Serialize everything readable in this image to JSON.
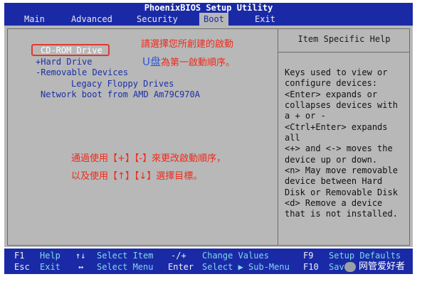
{
  "title": "PhoenixBIOS Setup Utility",
  "menu": {
    "items": [
      {
        "label": "Main"
      },
      {
        "label": "Advanced"
      },
      {
        "label": "Security"
      },
      {
        "label": "Boot"
      },
      {
        "label": "Exit"
      }
    ],
    "active": "Boot"
  },
  "boot": {
    "items": [
      {
        "label": "CD-ROM Drive",
        "selected": true
      },
      {
        "label": "+Hard Drive"
      },
      {
        "label": "-Removable Devices"
      },
      {
        "label": "Legacy Floppy Drives"
      },
      {
        "label": "Network boot from AMD Am79C970A"
      }
    ]
  },
  "help": {
    "title": "Item Specific Help",
    "lines": [
      "Keys used to view or",
      "configure devices:",
      "<Enter> expands or",
      "collapses devices with",
      "a + or -",
      "<Ctrl+Enter> expands",
      "all",
      "<+> and <-> moves the",
      "device up or down.",
      "<n> May move removable",
      "device between Hard",
      "Disk or Removable Disk",
      "<d> Remove a device",
      "that is not installed."
    ]
  },
  "annotations": {
    "top_line1": "請選擇您所創建的啟動",
    "top_u": "U盘",
    "top_line2_rest": "為第一啟動順序。",
    "mid_line1": "通過使用【+】【-】來更改啟動順序，",
    "mid_line2": "以及使用【↑】【↓】選擇目標。"
  },
  "footer": {
    "row1": [
      {
        "key": "F1",
        "desc": "Help"
      },
      {
        "key": "↑↓",
        "desc": "Select Item"
      },
      {
        "key": "-/+",
        "desc": "Change Values"
      },
      {
        "key": "F9",
        "desc": "Setup Defaults"
      }
    ],
    "row2": [
      {
        "key": "Esc",
        "desc": "Exit"
      },
      {
        "key": "↔",
        "desc": "Select Menu"
      },
      {
        "key": "Enter",
        "desc": "Select ▶ Sub-Menu"
      },
      {
        "key": "F10",
        "desc": "Save"
      }
    ]
  },
  "watermark": "网管爱好者",
  "colors": {
    "bios_blue": "#1a2aa6",
    "panel_gray": "#b8b8b8",
    "annotation_red": "#f02a1a",
    "footer_cyan": "#7fd8e8"
  }
}
